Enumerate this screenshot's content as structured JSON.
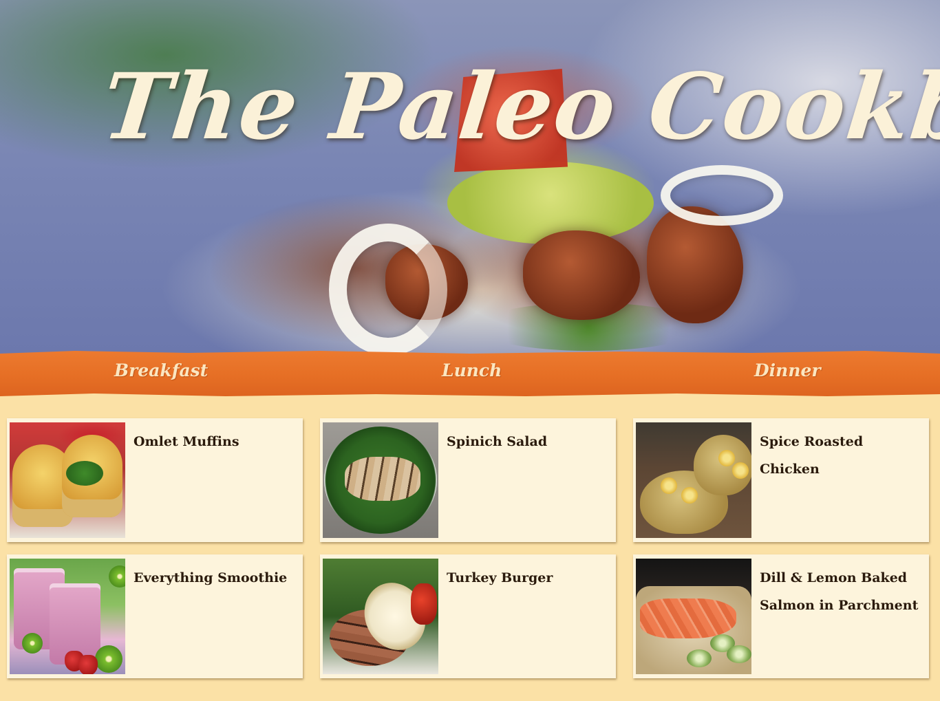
{
  "header": {
    "title": "The Paleo Cookbook"
  },
  "nav": {
    "items": [
      {
        "label": "Breakfast"
      },
      {
        "label": "Lunch"
      },
      {
        "label": "Dinner"
      }
    ]
  },
  "recipes": {
    "breakfast": [
      {
        "title": "Omlet Muffins",
        "image": "omelet-muffins-photo"
      },
      {
        "title": "Everything Smoothie",
        "image": "smoothie-photo"
      }
    ],
    "lunch": [
      {
        "title": "Spinich Salad",
        "image": "spinach-salad-photo"
      },
      {
        "title": "Turkey Burger",
        "image": "turkey-burger-photo"
      }
    ],
    "dinner": [
      {
        "title": "Spice Roasted Chicken",
        "image": "roasted-chicken-photo"
      },
      {
        "title": "Dill & Lemon Baked Salmon in Parchment",
        "image": "baked-salmon-photo"
      }
    ]
  },
  "colors": {
    "nav_bar": "#e66f25",
    "page_background": "#fbe1a6",
    "card_background": "#fdf4dc",
    "title_text": "#fbf1d8"
  }
}
